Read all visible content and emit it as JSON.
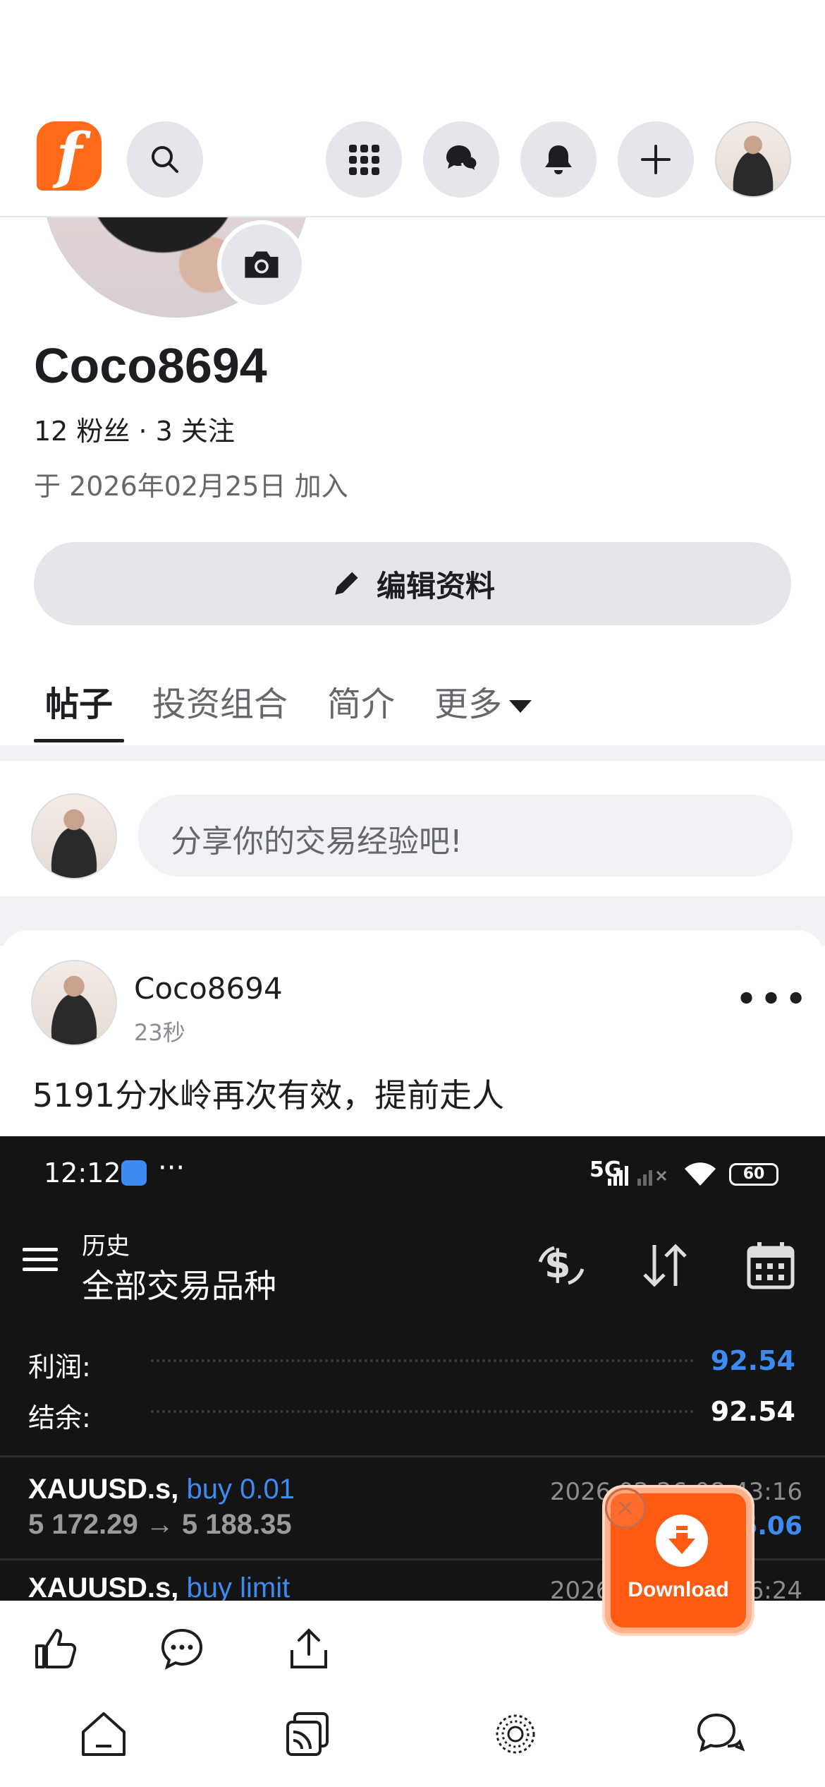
{
  "app": {
    "logo_letter": "f",
    "accent": "#ff6a1a"
  },
  "icons": [
    "search-icon",
    "apps-grid-icon",
    "messages-icon",
    "bell-icon",
    "plus-icon",
    "camera-icon",
    "pencil-icon",
    "like-icon",
    "comment-icon",
    "share-icon",
    "home-icon",
    "feed-icon",
    "explore-icon",
    "chat-icon",
    "download-icon"
  ],
  "profile": {
    "username": "Coco8694",
    "stats": "12 粉丝 · 3 关注",
    "joined": "于 2026年02月25日 加入",
    "edit_label": "编辑资料"
  },
  "tabs": [
    {
      "label": "帖子",
      "active": true
    },
    {
      "label": "投资组合",
      "active": false
    },
    {
      "label": "简介",
      "active": false
    },
    {
      "label": "更多",
      "active": false
    }
  ],
  "composer": {
    "placeholder": "分享你的交易经验吧!"
  },
  "post": {
    "author": "Coco8694",
    "time": "23秒",
    "text": "5191分水岭再次有效，提前走人",
    "screenshot": {
      "status_time": "12:12",
      "network": "5G",
      "battery": "60",
      "header_small": "历史",
      "header_title": "全部交易品种",
      "profit_label": "利润:",
      "profit_value": "92.54",
      "balance_label": "结余:",
      "balance_value": "92.54",
      "trades": [
        {
          "symbol": "XAUUSD.s,",
          "side": "buy 0.01",
          "prices": "5 172.29 → 5 188.35",
          "datetime": "2026.02.26 08:43:16",
          "pl": "16.06"
        },
        {
          "symbol": "XAUUSD.s,",
          "side": "buy limit",
          "prices": "",
          "datetime": "2026.02.26 08:06:24",
          "pl": ""
        }
      ]
    }
  },
  "download_badge": {
    "label": "Download"
  }
}
